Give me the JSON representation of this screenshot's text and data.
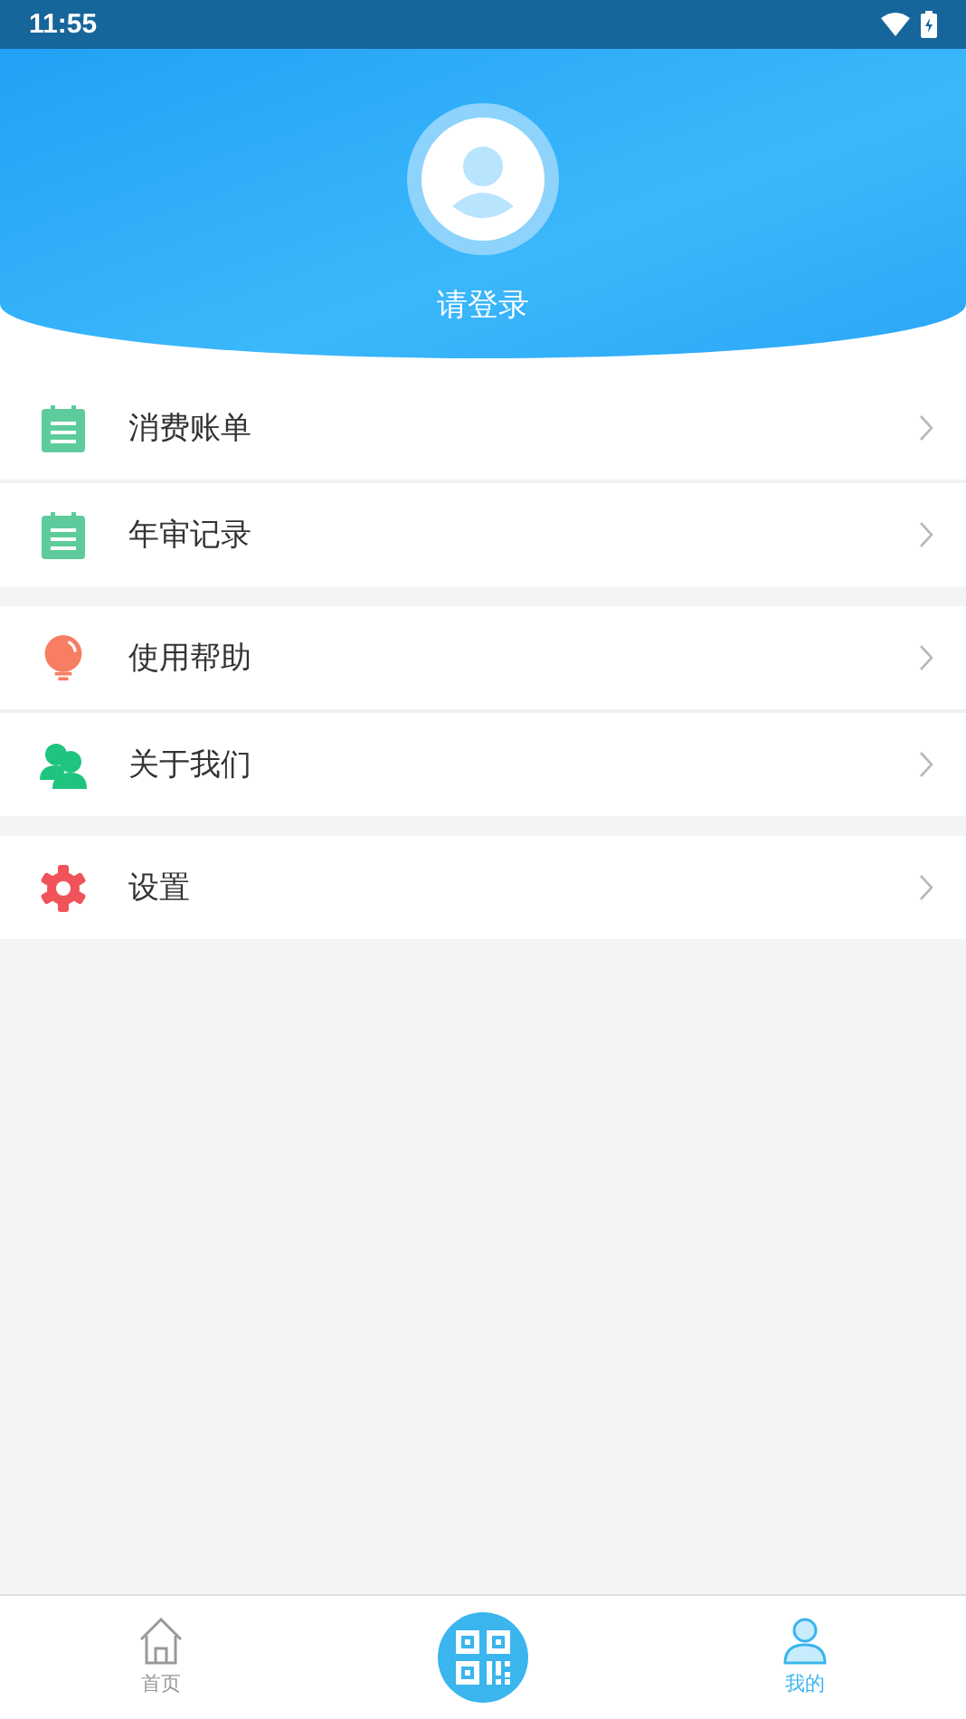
{
  "status_bar": {
    "time": "11:55"
  },
  "header": {
    "login_text": "请登录"
  },
  "menu_groups": [
    {
      "items": [
        {
          "kind": "notepad",
          "label": "消费账单"
        },
        {
          "kind": "notepad",
          "label": "年审记录"
        }
      ]
    },
    {
      "items": [
        {
          "kind": "bulb",
          "label": "使用帮助"
        },
        {
          "kind": "people",
          "label": "关于我们"
        }
      ]
    },
    {
      "items": [
        {
          "kind": "gear",
          "label": "设置"
        }
      ]
    }
  ],
  "bottom_nav": [
    {
      "kind": "home",
      "label": "首页",
      "selected": false
    },
    {
      "kind": "scan",
      "selected": false
    },
    {
      "kind": "mine",
      "label": "我的",
      "selected": true
    }
  ]
}
